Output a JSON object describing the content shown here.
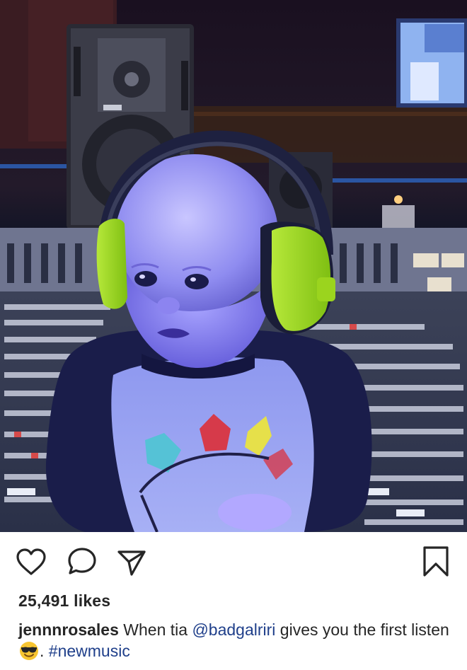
{
  "post": {
    "photo_alt": "",
    "likes_text": "25,491 likes",
    "caption": {
      "username": "jennnrosales",
      "text_before_mention": "When tia",
      "mention": "@badgalriri",
      "text_after_mention": "gives you the first listen",
      "emoji": "smiling-face-with-sunglasses",
      "punctuation": ".",
      "hashtag": "#newmusic"
    }
  },
  "icons": {
    "like": "heart-icon",
    "comment": "comment-icon",
    "share": "send-icon",
    "save": "bookmark-icon"
  },
  "colors": {
    "text": "#262626",
    "link": "#1f3f8a",
    "headphones": "#9fd11c"
  }
}
